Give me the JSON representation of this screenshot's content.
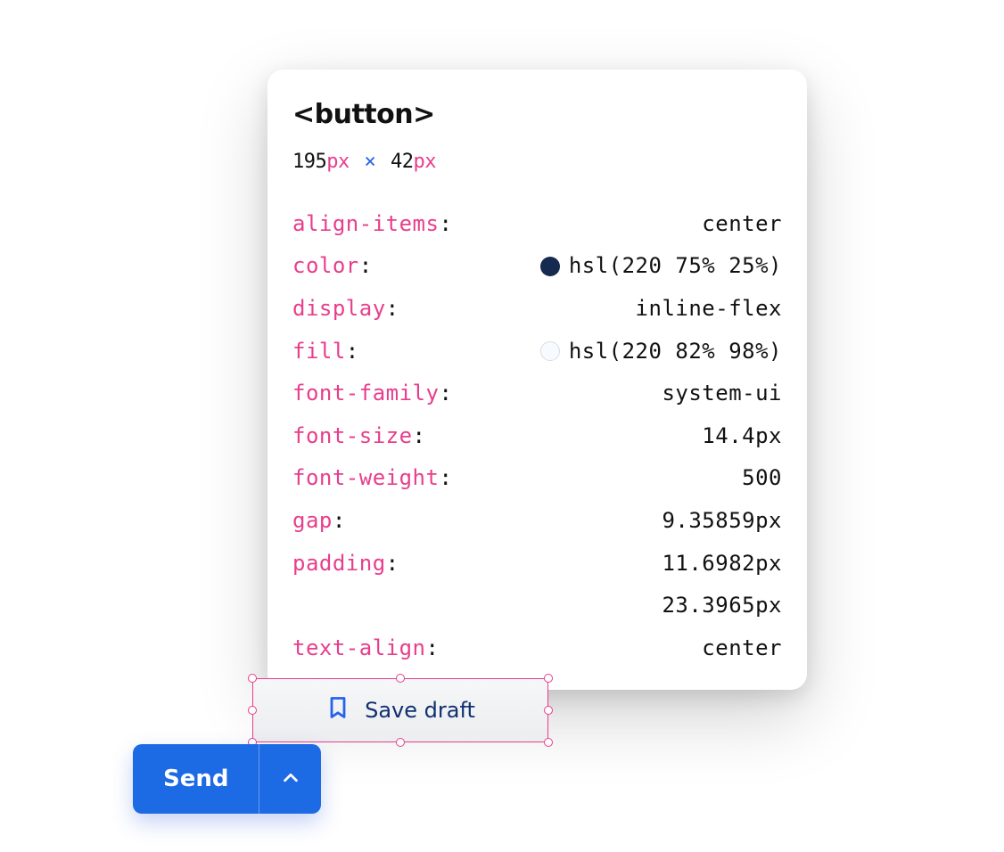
{
  "inspector": {
    "tag": "<button>",
    "width_value": "195",
    "height_value": "42",
    "px_unit": "px",
    "times": "×",
    "props": {
      "0": {
        "name": "align-items",
        "value": "center"
      },
      "1": {
        "name": "color",
        "value": "hsl(220 75% 25%)",
        "swatch": "#16294f"
      },
      "2": {
        "name": "display",
        "value": "inline-flex"
      },
      "3": {
        "name": "fill",
        "value": "hsl(220 82% 98%)",
        "swatch": "#f7faff"
      },
      "4": {
        "name": "font-family",
        "value": "system-ui"
      },
      "5": {
        "name": "font-size",
        "value": "14.4px"
      },
      "6": {
        "name": "font-weight",
        "value": "500"
      },
      "7": {
        "name": "gap",
        "value": "9.35859px"
      },
      "8": {
        "name": "padding",
        "value": "11.6982px",
        "value2": "23.3965px"
      },
      "9": {
        "name": "text-align",
        "value": "center"
      }
    }
  },
  "savedraft": {
    "label": "Save draft",
    "icon": "bookmark-icon"
  },
  "send": {
    "label": "Send"
  }
}
